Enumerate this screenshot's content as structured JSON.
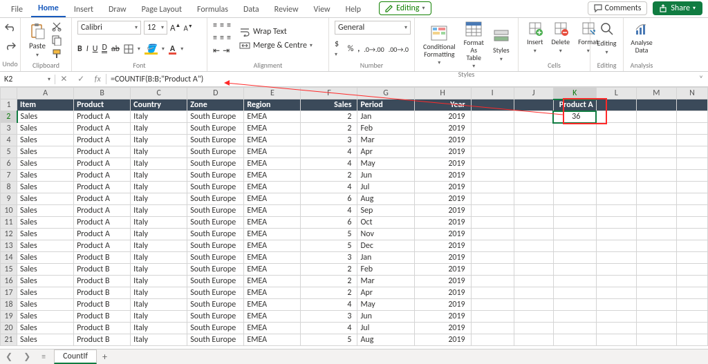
{
  "tabs": [
    "File",
    "Home",
    "Insert",
    "Draw",
    "Page Layout",
    "Formulas",
    "Data",
    "Review",
    "View",
    "Help"
  ],
  "active_tab": "Home",
  "editing_btn": "Editing",
  "comments_btn": "Comments",
  "share_btn": "Share",
  "ribbon": {
    "undo_label": "Undo",
    "clipboard": {
      "paste": "Paste",
      "label": "Clipboard"
    },
    "font": {
      "name": "Calibri",
      "size": "12",
      "label": "Font"
    },
    "alignment": {
      "wrap": "Wrap Text",
      "merge": "Merge & Centre",
      "label": "Alignment"
    },
    "number": {
      "format": "General",
      "label": "Number"
    },
    "styles": {
      "cond": "Conditional Formatting",
      "table": "Format As Table",
      "styles": "Styles",
      "label": "Styles"
    },
    "cells": {
      "insert": "Insert",
      "delete": "Delete",
      "format": "Format",
      "label": "Cells"
    },
    "editing_grp": {
      "editing": "Editing",
      "analyse": "Analyse Data",
      "label_e": "Editing",
      "label_a": "Analysis"
    }
  },
  "name_box": "K2",
  "formula": "=COUNTIF(B:B;\"Product A\")",
  "columns": [
    "A",
    "B",
    "C",
    "D",
    "E",
    "F",
    "G",
    "H",
    "I",
    "J",
    "K",
    "L",
    "M",
    "N"
  ],
  "header_row": {
    "item": "Item",
    "product": "Product",
    "country": "Country",
    "zone": "Zone",
    "region": "Region",
    "sales": "Sales",
    "period": "Period",
    "year": "Year",
    "k": "Product A"
  },
  "k2_value": "36",
  "rows": [
    {
      "n": 2,
      "item": "Sales",
      "product": "Product A",
      "country": "Italy",
      "zone": "South Europe",
      "region": "EMEA",
      "sales": 2,
      "period": "Jan",
      "year": 2019
    },
    {
      "n": 3,
      "item": "Sales",
      "product": "Product A",
      "country": "Italy",
      "zone": "South Europe",
      "region": "EMEA",
      "sales": 2,
      "period": "Feb",
      "year": 2019
    },
    {
      "n": 4,
      "item": "Sales",
      "product": "Product A",
      "country": "Italy",
      "zone": "South Europe",
      "region": "EMEA",
      "sales": 3,
      "period": "Mar",
      "year": 2019
    },
    {
      "n": 5,
      "item": "Sales",
      "product": "Product A",
      "country": "Italy",
      "zone": "South Europe",
      "region": "EMEA",
      "sales": 4,
      "period": "Apr",
      "year": 2019
    },
    {
      "n": 6,
      "item": "Sales",
      "product": "Product A",
      "country": "Italy",
      "zone": "South Europe",
      "region": "EMEA",
      "sales": 4,
      "period": "May",
      "year": 2019
    },
    {
      "n": 7,
      "item": "Sales",
      "product": "Product A",
      "country": "Italy",
      "zone": "South Europe",
      "region": "EMEA",
      "sales": 2,
      "period": "Jun",
      "year": 2019
    },
    {
      "n": 8,
      "item": "Sales",
      "product": "Product A",
      "country": "Italy",
      "zone": "South Europe",
      "region": "EMEA",
      "sales": 4,
      "period": "Jul",
      "year": 2019
    },
    {
      "n": 9,
      "item": "Sales",
      "product": "Product A",
      "country": "Italy",
      "zone": "South Europe",
      "region": "EMEA",
      "sales": 6,
      "period": "Aug",
      "year": 2019
    },
    {
      "n": 10,
      "item": "Sales",
      "product": "Product A",
      "country": "Italy",
      "zone": "South Europe",
      "region": "EMEA",
      "sales": 4,
      "period": "Sep",
      "year": 2019
    },
    {
      "n": 11,
      "item": "Sales",
      "product": "Product A",
      "country": "Italy",
      "zone": "South Europe",
      "region": "EMEA",
      "sales": 6,
      "period": "Oct",
      "year": 2019
    },
    {
      "n": 12,
      "item": "Sales",
      "product": "Product A",
      "country": "Italy",
      "zone": "South Europe",
      "region": "EMEA",
      "sales": 5,
      "period": "Nov",
      "year": 2019
    },
    {
      "n": 13,
      "item": "Sales",
      "product": "Product A",
      "country": "Italy",
      "zone": "South Europe",
      "region": "EMEA",
      "sales": 5,
      "period": "Dec",
      "year": 2019
    },
    {
      "n": 14,
      "item": "Sales",
      "product": "Product B",
      "country": "Italy",
      "zone": "South Europe",
      "region": "EMEA",
      "sales": 3,
      "period": "Jan",
      "year": 2019
    },
    {
      "n": 15,
      "item": "Sales",
      "product": "Product B",
      "country": "Italy",
      "zone": "South Europe",
      "region": "EMEA",
      "sales": 2,
      "period": "Feb",
      "year": 2019
    },
    {
      "n": 16,
      "item": "Sales",
      "product": "Product B",
      "country": "Italy",
      "zone": "South Europe",
      "region": "EMEA",
      "sales": 2,
      "period": "Mar",
      "year": 2019
    },
    {
      "n": 17,
      "item": "Sales",
      "product": "Product B",
      "country": "Italy",
      "zone": "South Europe",
      "region": "EMEA",
      "sales": 2,
      "period": "Apr",
      "year": 2019
    },
    {
      "n": 18,
      "item": "Sales",
      "product": "Product B",
      "country": "Italy",
      "zone": "South Europe",
      "region": "EMEA",
      "sales": 4,
      "period": "May",
      "year": 2019
    },
    {
      "n": 19,
      "item": "Sales",
      "product": "Product B",
      "country": "Italy",
      "zone": "South Europe",
      "region": "EMEA",
      "sales": 3,
      "period": "Jun",
      "year": 2019
    },
    {
      "n": 20,
      "item": "Sales",
      "product": "Product B",
      "country": "Italy",
      "zone": "South Europe",
      "region": "EMEA",
      "sales": 4,
      "period": "Jul",
      "year": 2019
    },
    {
      "n": 21,
      "item": "Sales",
      "product": "Product B",
      "country": "Italy",
      "zone": "South Europe",
      "region": "EMEA",
      "sales": 5,
      "period": "Aug",
      "year": 2019
    }
  ],
  "sheet_tab": "CountIf"
}
